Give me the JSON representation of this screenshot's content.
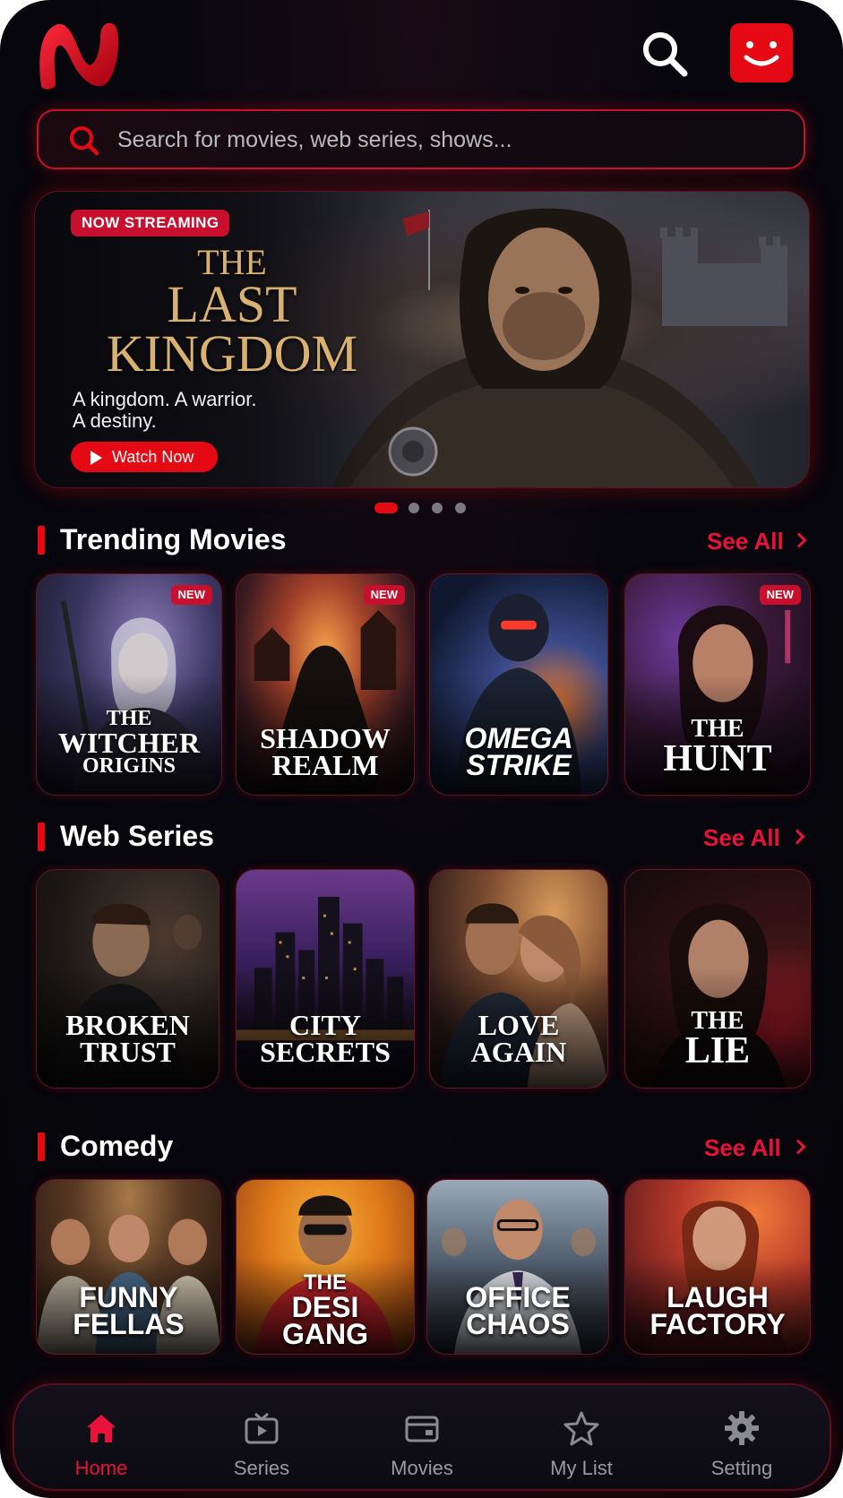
{
  "header": {
    "logo_icon": "n-logo-icon",
    "search_icon": "search-icon",
    "profile_icon": "smiley-avatar-icon",
    "accent_color": "#e50914"
  },
  "search": {
    "placeholder": "Search for movies, web series, shows..."
  },
  "hero": {
    "badge": "NOW STREAMING",
    "title_line1": "THE",
    "title_line2": "LAST",
    "title_line3": "KINGDOM",
    "tagline_line1": "A kingdom. A warrior.",
    "tagline_line2": "A destiny.",
    "cta": "Watch Now",
    "carousel_total": 4,
    "carousel_active": 1
  },
  "sections": [
    {
      "title": "Trending Movies",
      "see_all": "See All",
      "items": [
        {
          "line1": "THE",
          "line2": "WITCHER",
          "line3": "ORIGINS",
          "badge": "NEW"
        },
        {
          "line1": "",
          "line2": "SHADOW",
          "line3": "REALM",
          "badge": "NEW"
        },
        {
          "line1": "",
          "line2": "OMEGA",
          "line3": "STRIKE",
          "badge": ""
        },
        {
          "line1": "",
          "line2": "THE",
          "line3": "HUNT",
          "badge": "NEW"
        }
      ]
    },
    {
      "title": "Web Series",
      "see_all": "See All",
      "items": [
        {
          "line1": "",
          "line2": "BROKEN",
          "line3": "TRUST"
        },
        {
          "line1": "",
          "line2": "CITY",
          "line3": "SECRETS"
        },
        {
          "line1": "",
          "line2": "LOVE",
          "line3": "AGAIN"
        },
        {
          "line1": "",
          "line2": "THE",
          "line3": "LIE"
        }
      ]
    },
    {
      "title": "Comedy",
      "see_all": "See All",
      "items": [
        {
          "line1": "",
          "line2": "FUNNY",
          "line3": "FELLAS"
        },
        {
          "line1": "THE",
          "line2": "DESI",
          "line3": "GANG"
        },
        {
          "line1": "",
          "line2": "OFFICE",
          "line3": "CHAOS"
        },
        {
          "line1": "",
          "line2": "LAUGH",
          "line3": "FACTORY"
        }
      ]
    }
  ],
  "bottom_nav": [
    {
      "label": "Home",
      "icon": "home-icon",
      "active": true
    },
    {
      "label": "Series",
      "icon": "tv-icon",
      "active": false
    },
    {
      "label": "Movies",
      "icon": "film-ticket-icon",
      "active": false
    },
    {
      "label": "My List",
      "icon": "star-icon",
      "active": false
    },
    {
      "label": "Setting",
      "icon": "gear-icon",
      "active": false
    }
  ]
}
